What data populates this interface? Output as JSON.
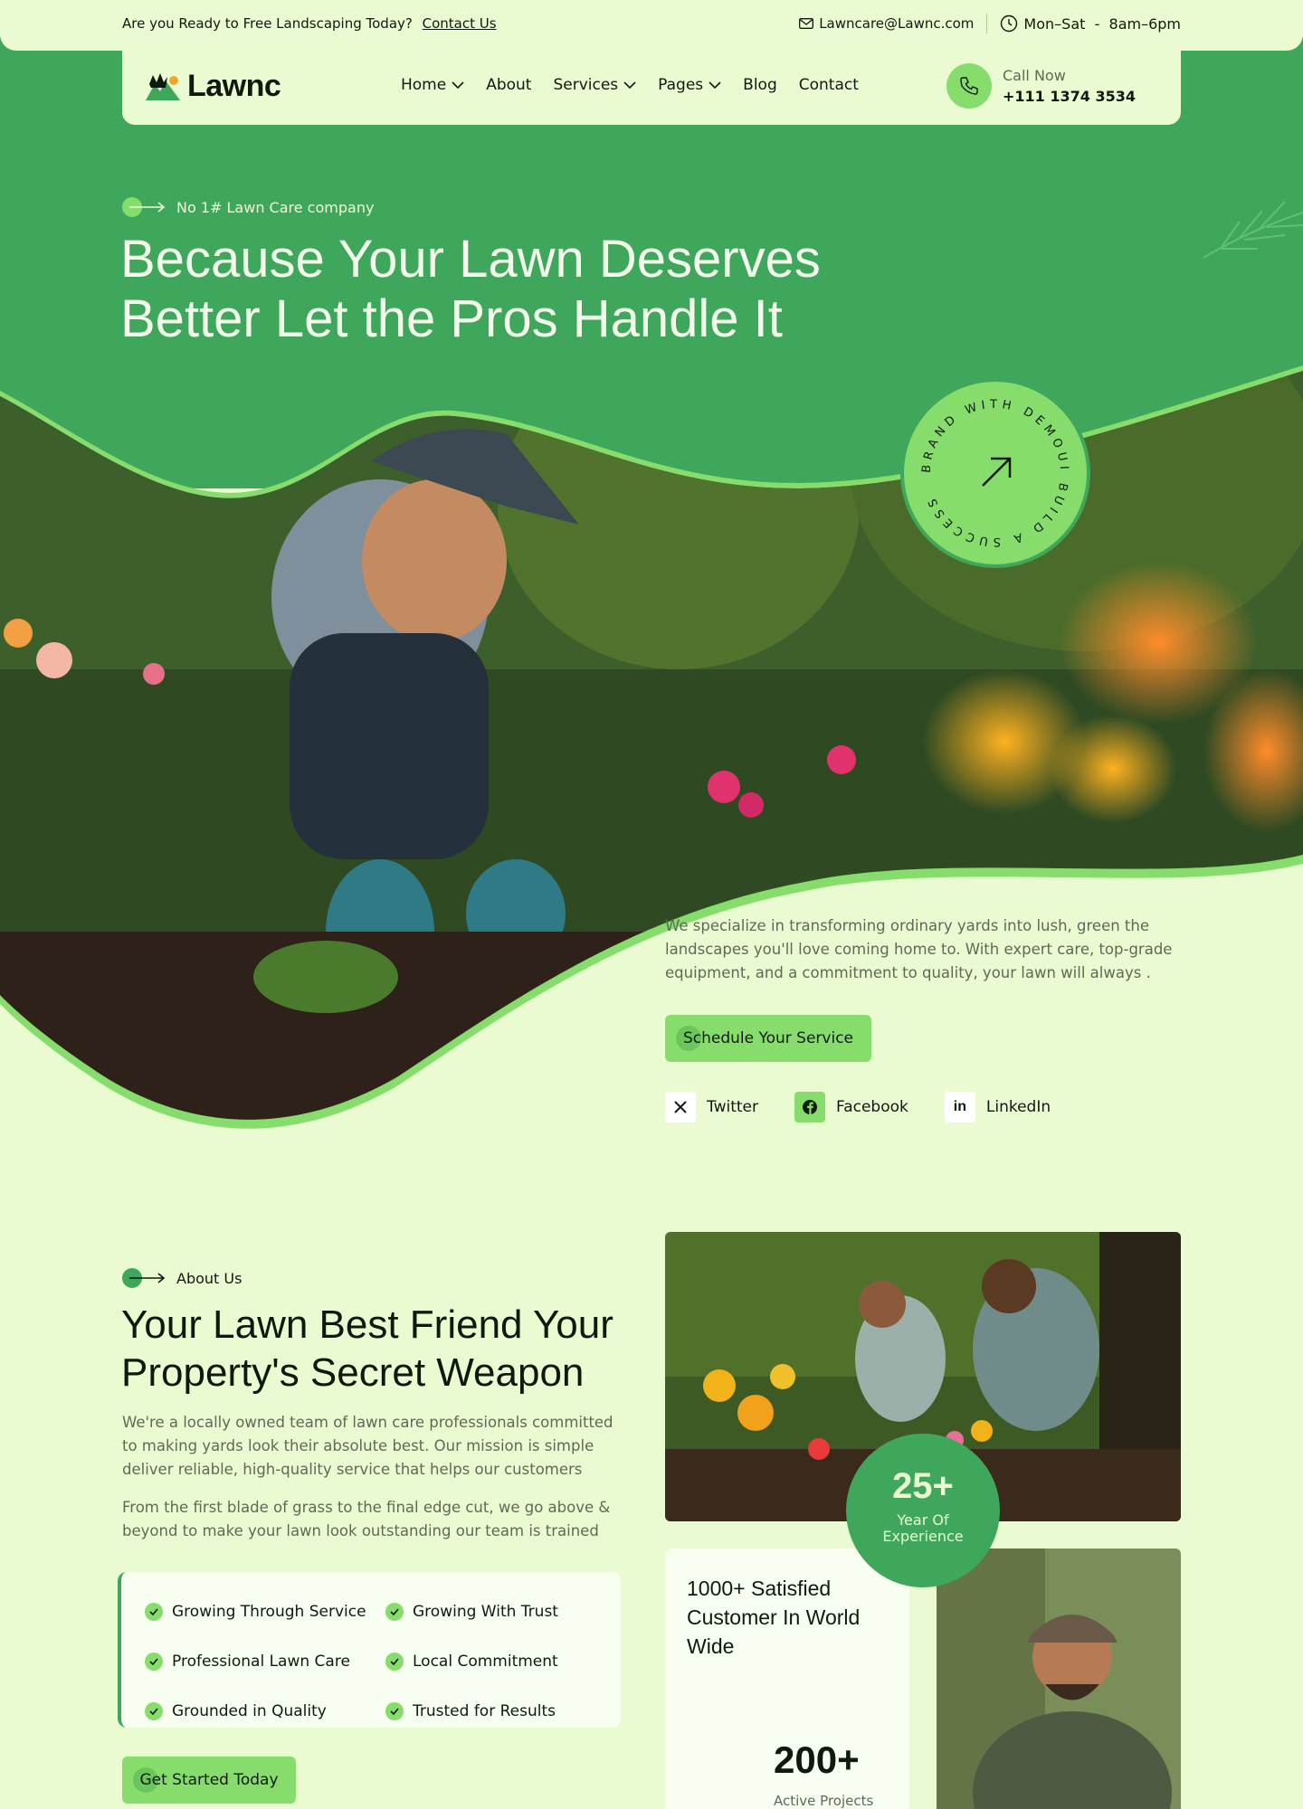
{
  "topbar": {
    "promo_text": "Are you Ready to Free Landscaping Today?",
    "contact_link": "Contact Us",
    "email": "Lawncare@Lawnc.com",
    "hours": "Mon–Sat  -  8am–6pm"
  },
  "nav": {
    "logo": "Lawnc",
    "menu": [
      {
        "label": "Home",
        "has_dropdown": true
      },
      {
        "label": "About",
        "has_dropdown": false
      },
      {
        "label": "Services",
        "has_dropdown": true
      },
      {
        "label": "Pages",
        "has_dropdown": true
      },
      {
        "label": "Blog",
        "has_dropdown": false
      },
      {
        "label": "Contact",
        "has_dropdown": false
      }
    ],
    "call_label": "Call Now",
    "call_phone": "+111 1374 3534"
  },
  "hero": {
    "eyebrow": "No 1# Lawn Care company",
    "title_line1": "Because Your Lawn Deserves",
    "title_line2": "Better Let the Pros Handle It",
    "badge_text": "BRAND WITH DEMOUI BUILD A SUCCESS",
    "description": "We specialize in transforming ordinary yards into lush, green the landscapes you'll love coming home to. With expert care, top-grade equipment, and a commitment to quality, your lawn will always .",
    "cta": "Schedule Your Service",
    "socials": [
      {
        "label": "Twitter",
        "icon": "x-icon"
      },
      {
        "label": "Facebook",
        "icon": "facebook-icon"
      },
      {
        "label": "LinkedIn",
        "icon": "linkedin-icon"
      }
    ]
  },
  "about": {
    "eyebrow": "About Us",
    "title_line1": "Your Lawn Best Friend Your",
    "title_line2": "Property's Secret Weapon",
    "paragraph1": "We're a locally owned team of lawn care professionals committed to making yards look their absolute best. Our mission is simple deliver reliable, high-quality service that helps our customers",
    "paragraph2": "From the first blade of grass to the final edge cut, we go above & beyond to make your lawn look outstanding our team is trained",
    "checklist": [
      "Growing Through Service",
      "Growing With Trust",
      "Professional Lawn Care",
      "Local Commitment",
      "Grounded in Quality",
      "Trusted for Results"
    ],
    "cta": "Get Started Today",
    "experience_number": "25+",
    "experience_label_line1": "Year Of",
    "experience_label_line2": "Experience",
    "customers_text": "1000+ Satisfied Customer In World Wide",
    "projects_number": "200+",
    "projects_label": "Active Projects"
  },
  "colors": {
    "primary_green": "#3fa75c",
    "light_green": "#86dd6c",
    "background": "#eafbd1"
  }
}
